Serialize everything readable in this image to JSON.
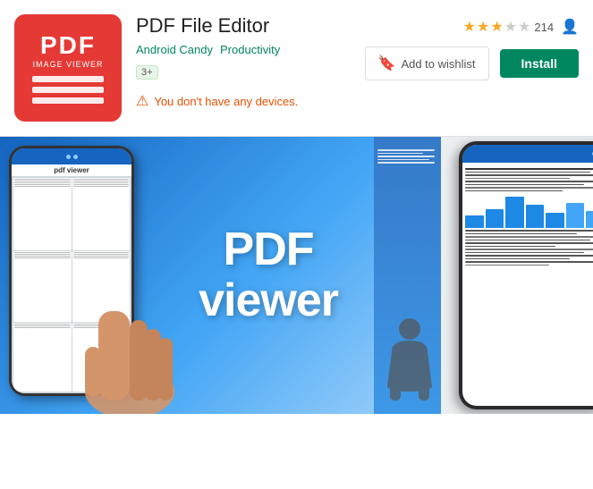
{
  "app": {
    "title": "PDF File Editor",
    "developer": "Android Candy",
    "category": "Productivity",
    "rating_badge": "3+",
    "rating_value": "★★½",
    "rating_count": "214",
    "warning_text": "You don't have any devices.",
    "wishlist_label": "Add to wishlist",
    "install_label": "Install",
    "stars": [
      {
        "type": "filled"
      },
      {
        "type": "filled"
      },
      {
        "type": "half"
      },
      {
        "type": "empty"
      },
      {
        "type": "empty"
      }
    ]
  },
  "screenshots": {
    "left_label": "pdf viewer",
    "overlay_line1": "PDF",
    "overlay_line2": "viewer"
  },
  "colors": {
    "green": "#01875f",
    "red": "#e53935",
    "warning": "#e65100",
    "star": "#f9a825"
  }
}
